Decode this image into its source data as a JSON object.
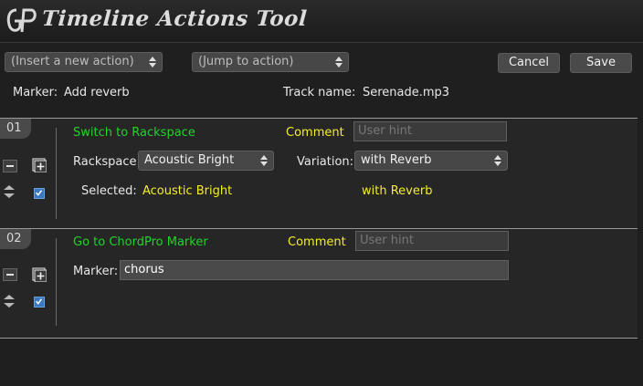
{
  "window": {
    "title": "Timeline Actions Tool"
  },
  "toolbar": {
    "insert_action": "(Insert a new action)",
    "jump_to_action": "(Jump to action)",
    "cancel_label": "Cancel",
    "save_label": "Save"
  },
  "info": {
    "marker_label": "Marker:",
    "marker_value": "Add reverb",
    "track_label": "Track name:",
    "track_value": "Serenade.mp3"
  },
  "actions": [
    {
      "number": "01",
      "title": "Switch to Rackspace",
      "comment_label": "Comment",
      "comment_placeholder": "User hint",
      "rackspace_label": "Rackspace:",
      "rackspace_value": "Acoustic Bright",
      "variation_label": "Variation:",
      "variation_value": "with Reverb",
      "selected_label": "Selected:",
      "selected_rackspace": "Acoustic Bright",
      "selected_variation": "with Reverb",
      "enabled": true
    },
    {
      "number": "02",
      "title": "Go to ChordPro Marker",
      "comment_label": "Comment",
      "comment_placeholder": "User hint",
      "marker_label": "Marker:",
      "marker_value": "chorus",
      "enabled": true
    }
  ],
  "colors": {
    "background": "#1f1f1f",
    "action_title": "#23d32a",
    "comment_label": "#f4ee2a",
    "checkbox": "#3a78c0"
  },
  "icons": [
    "app-logo-icon",
    "updown-arrows-icon",
    "minus-icon",
    "add-icon",
    "move-updown-icon",
    "checkbox-checked-icon"
  ]
}
